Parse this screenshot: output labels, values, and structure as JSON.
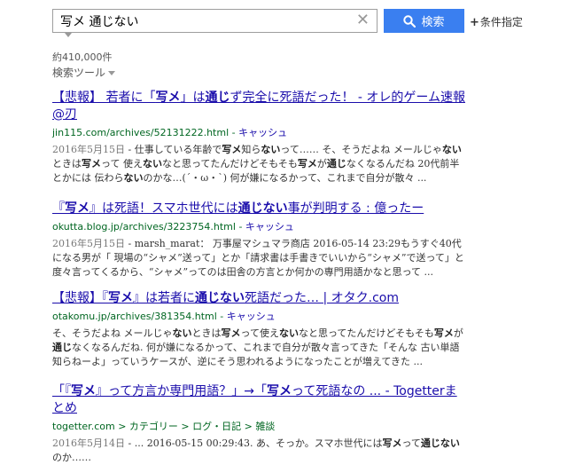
{
  "search": {
    "value": "写メ 通じない",
    "clear_icon": "close-icon",
    "button_label": "検索",
    "button_icon": "search-icon"
  },
  "colors": {
    "search_button": "#3a7ff0",
    "link": "#1a0dab",
    "url": "#006621"
  },
  "advanced": {
    "plus": "+",
    "label": "条件指定"
  },
  "result_count": "約410,000件",
  "tools_label": "検索ツール",
  "results": [
    {
      "title": [
        {
          "t": "【悲報】 若者に「",
          "b": false
        },
        {
          "t": "写メ",
          "b": true
        },
        {
          "t": "」は",
          "b": false
        },
        {
          "t": "通じ",
          "b": true
        },
        {
          "t": "ず完全に死語だった！ - オレ的ゲーム速報@刃",
          "b": false
        }
      ],
      "url": "jin115.com/archives/52131222.html",
      "sep": " - ",
      "cache": "キャッシュ",
      "snippet": [
        {
          "t": "2016年5月15日",
          "d": true
        },
        {
          "t": " - 仕事している年齢で"
        },
        {
          "t": "写メ",
          "b": true
        },
        {
          "t": "知ら"
        },
        {
          "t": "ない",
          "b": true
        },
        {
          "t": "って…… そ、そうだよね メールじゃ"
        },
        {
          "t": "ない",
          "b": true
        },
        {
          "t": "ときは"
        },
        {
          "t": "写メ",
          "b": true
        },
        {
          "t": "って 使え"
        },
        {
          "t": "ない",
          "b": true
        },
        {
          "t": "なと思ってたんだけどそもそも"
        },
        {
          "t": "写メ",
          "b": true
        },
        {
          "t": "が"
        },
        {
          "t": "通じ",
          "b": true
        },
        {
          "t": "なくなるんだね 20代前半とかには 伝わら"
        },
        {
          "t": "ない",
          "b": true
        },
        {
          "t": "のかな…(´・ω・`) 何が嫌になるかって、これまで自分が散々 ..."
        }
      ]
    },
    {
      "title": [
        {
          "t": "『",
          "b": false
        },
        {
          "t": "写メ",
          "b": true
        },
        {
          "t": "』は死語！スマホ世代には",
          "b": false
        },
        {
          "t": "通じない",
          "b": true
        },
        {
          "t": "事が判明する : 億ったー",
          "b": false
        }
      ],
      "url": "okutta.blog.jp/archives/3223754.html",
      "sep": " - ",
      "cache": "キャッシュ",
      "snippet": [
        {
          "t": "2016年5月15日",
          "d": true
        },
        {
          "t": " - marsh_marat： 万事屋マシュマラ商店 2016-05-14 23:29もうすぐ40代になる男が「 現場の“シャメ”送って」とか「請求書は手書きでいいから“シャメ”で送って」と度々言ってくるから、“シャメ”ってのは田舎の方言とか何かの専門用語かなと思って ..."
        }
      ]
    },
    {
      "title": [
        {
          "t": "【悲報】『",
          "b": false
        },
        {
          "t": "写メ",
          "b": true
        },
        {
          "t": "』は若者に",
          "b": false
        },
        {
          "t": "通じない",
          "b": true
        },
        {
          "t": "死語だった… | オタク.com",
          "b": false
        }
      ],
      "url": "otakomu.jp/archives/381354.html",
      "sep": " - ",
      "cache": "キャッシュ",
      "snippet": [
        {
          "t": "そ、そうだよね メールじゃ"
        },
        {
          "t": "ない",
          "b": true
        },
        {
          "t": "ときは"
        },
        {
          "t": "写メ",
          "b": true
        },
        {
          "t": "って使え"
        },
        {
          "t": "ない",
          "b": true
        },
        {
          "t": "なと思ってたんだけどそもそも"
        },
        {
          "t": "写メ",
          "b": true
        },
        {
          "t": "が"
        },
        {
          "t": "通じ",
          "b": true
        },
        {
          "t": "なくなるんだね. 何が嫌になるかって、これまで自分が散々言ってきた「そんな 古い単語知らねーよ」っていうケースが、逆にそう思われるようになったことが増えてきた ..."
        }
      ]
    },
    {
      "title": [
        {
          "t": "「『",
          "b": false
        },
        {
          "t": "写メ",
          "b": true
        },
        {
          "t": "』って方言か専門用語？」→「",
          "b": false
        },
        {
          "t": "写メ",
          "b": true
        },
        {
          "t": "って死語なの ... - Togetterまとめ",
          "b": false
        }
      ],
      "url": "togetter.com",
      "sep": " > ",
      "breadcrumb": "カテゴリー > ログ・日記 > 雑談",
      "snippet": [
        {
          "t": "2016年5月14日",
          "d": true
        },
        {
          "t": " - ... 2016-05-15 00:29:43. あ、そっか。スマホ世代には"
        },
        {
          "t": "写メ",
          "b": true
        },
        {
          "t": "って"
        },
        {
          "t": "通じない",
          "b": true
        },
        {
          "t": "のか……"
        }
      ]
    }
  ]
}
